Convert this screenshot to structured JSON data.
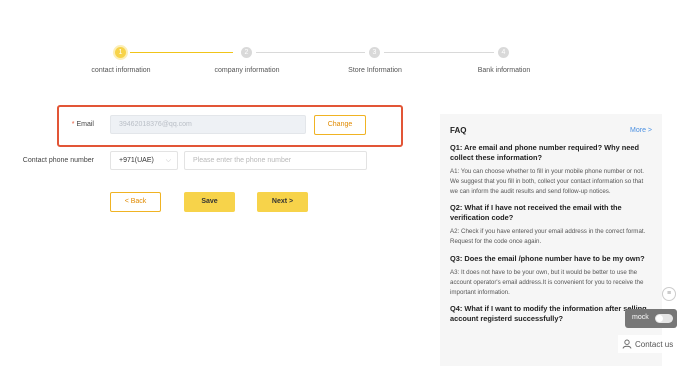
{
  "stepper": {
    "steps": [
      {
        "number": "1",
        "label": "contact information",
        "active": true
      },
      {
        "number": "2",
        "label": "company information",
        "active": false
      },
      {
        "number": "3",
        "label": "Store Information",
        "active": false
      },
      {
        "number": "4",
        "label": "Bank information",
        "active": false
      }
    ]
  },
  "form": {
    "email": {
      "required_mark": "*",
      "label": "Email",
      "value": "39462018376@qq.com",
      "change_button": "Change"
    },
    "phone": {
      "label": "Contact phone number",
      "country_code": "+971(UAE)",
      "placeholder": "Please enter the phone number"
    },
    "buttons": {
      "back": "< Back",
      "save": "Save",
      "next": "Next >"
    }
  },
  "faq": {
    "title": "FAQ",
    "more": "More >",
    "items": [
      {
        "q": "Q1: Are email and phone number required? Why need collect these information?",
        "a": "A1: You can choose whether to fill in your mobile phone number or not. We suggest that you fill in both, collect your contact information so that we can inform the audit results and send follow-up notices."
      },
      {
        "q": "Q2: What if I have not received the email with the verification code?",
        "a": "A2: Check if you have entered your email address in the correct format. Request for the code once again."
      },
      {
        "q": "Q3: Does the email /phone number have to be my own?",
        "a": "A3: It does not have to be your own, but it would be better to use the account operator's email address.It is convenient for you to receive the important information."
      },
      {
        "q": "Q4: What if I want to modify the information after selling account registerd successfully?",
        "a": ""
      }
    ]
  },
  "widgets": {
    "scroll_symbol": "≡",
    "mock_label": "mock",
    "mock_enabled": false,
    "contact_us": "Contact us"
  },
  "colors": {
    "accent": "#f7d34a",
    "highlight_border": "#e25536",
    "link": "#4a90e2"
  }
}
